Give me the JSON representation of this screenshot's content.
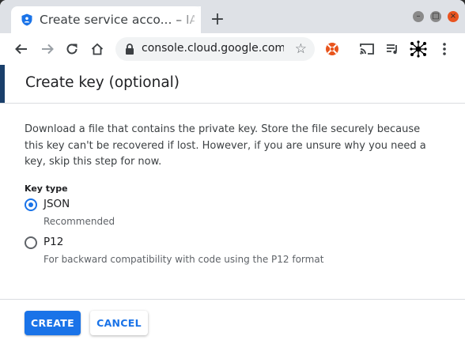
{
  "browser": {
    "tab_title": "Create service acco... – IAM",
    "new_tab_symbol": "+",
    "url": "console.cloud.google.com...",
    "controls": {
      "minimize": "–",
      "maximize": "□",
      "close": "×"
    }
  },
  "dialog": {
    "title": "Create key (optional)",
    "description": "Download a file that contains the private key. Store the file securely because this key can't be recovered if lost. However, if you are unsure why you need a key, skip this step for now.",
    "key_type_label": "Key type",
    "options": [
      {
        "label": "JSON",
        "sublabel": "Recommended",
        "selected": true
      },
      {
        "label": "P12",
        "sublabel": "For backward compatibility with code using the P12 format",
        "selected": false
      }
    ],
    "create_label": "CREATE",
    "cancel_label": "CANCEL"
  },
  "colors": {
    "accent": "#1a73e8",
    "close_button": "#e95420"
  }
}
